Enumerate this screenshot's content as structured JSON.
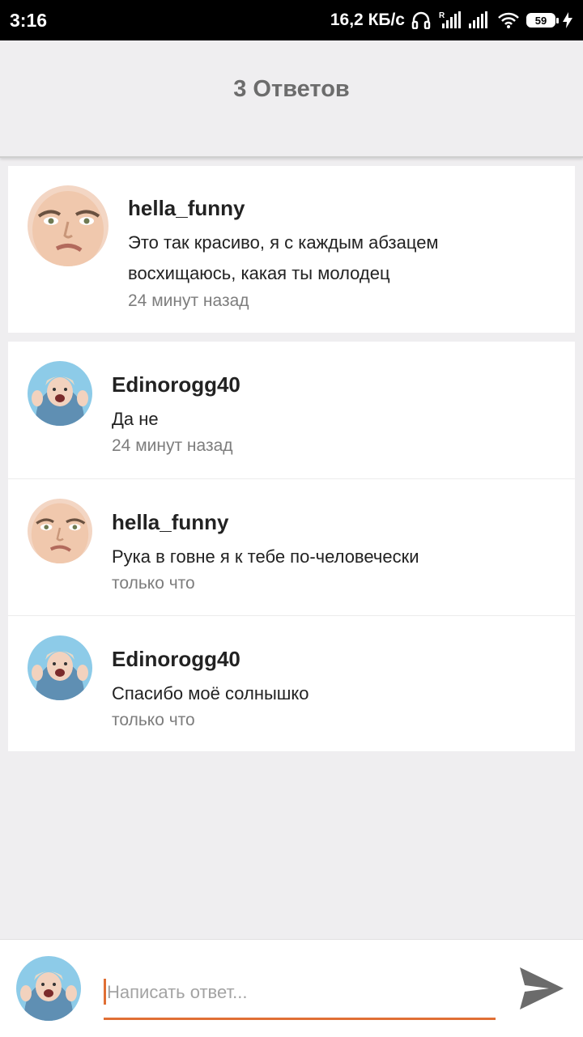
{
  "status_bar": {
    "time": "3:16",
    "speed": "16,2 КБ/с",
    "battery": "59",
    "icons": [
      "headphones-icon",
      "signal-r-icon",
      "signal-icon",
      "wifi-icon",
      "battery-icon",
      "charging-icon"
    ]
  },
  "header": {
    "title": "3 Ответов"
  },
  "main_comment": {
    "author": "hella_funny",
    "text": "Это так красиво, я с каждым абзацем восхищаюсь, какая ты молодец",
    "time": "24 минут назад"
  },
  "replies": [
    {
      "author": "Edinorogg40",
      "text": "Да не",
      "time": "24 минут назад"
    },
    {
      "author": "hella_funny",
      "text": "Рука в говне я к тебе по-человечески",
      "time": "только что"
    },
    {
      "author": "Edinorogg40",
      "text": "Спасибо моё солнышко",
      "time": "только что"
    }
  ],
  "composer": {
    "placeholder": "Написать ответ...",
    "send_icon": "send-icon"
  },
  "colors": {
    "accent": "#e06f35",
    "background": "#efeef0",
    "card": "#ffffff"
  }
}
